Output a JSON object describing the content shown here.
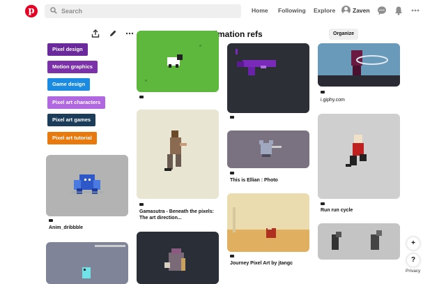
{
  "header": {
    "logo_letter": "p",
    "search_placeholder": "Search",
    "nav": [
      "Home",
      "Following",
      "Explore"
    ],
    "username": "Zaven",
    "icons": [
      "chat-icon",
      "bell-icon",
      "more-icon"
    ]
  },
  "board": {
    "title": "Pixel animation refs",
    "organize_label": "Organize",
    "tools": [
      "upload-icon",
      "edit-icon",
      "more-icon"
    ]
  },
  "sections": [
    {
      "label": "Pixel design",
      "color": "#6a2a9c"
    },
    {
      "label": "Motion graphics",
      "color": "#7b32a8"
    },
    {
      "label": "Game design",
      "color": "#1a8be0"
    },
    {
      "label": "Pixel art characters",
      "color": "#b067e0"
    },
    {
      "label": "Pixel art games",
      "color": "#1c3d5a"
    },
    {
      "label": "Pixel art tutorial",
      "color": "#e8790e"
    }
  ],
  "pins": {
    "col1": [
      {
        "caption": "Anim_dribbble"
      },
      {
        "caption": ""
      }
    ],
    "col2": [
      {
        "caption": ""
      },
      {
        "caption_line1": "Gamasutra - Beneath the pixels:",
        "caption_line2": "The art direction..."
      },
      {
        "caption": ""
      }
    ],
    "col3": [
      {
        "caption": ""
      },
      {
        "caption": "This is Ellian : Photo"
      },
      {
        "caption": "Journey Pixel Art by jtangc"
      }
    ],
    "col4": [
      {
        "caption": "i.giphy.com"
      },
      {
        "caption": "Run run cycle"
      },
      {
        "caption": ""
      }
    ]
  },
  "floating": {
    "add_label": "+",
    "help_label": "?",
    "privacy_label": "Privacy"
  },
  "colors": {
    "brand": "#e60023",
    "search_bg": "#efefef"
  }
}
